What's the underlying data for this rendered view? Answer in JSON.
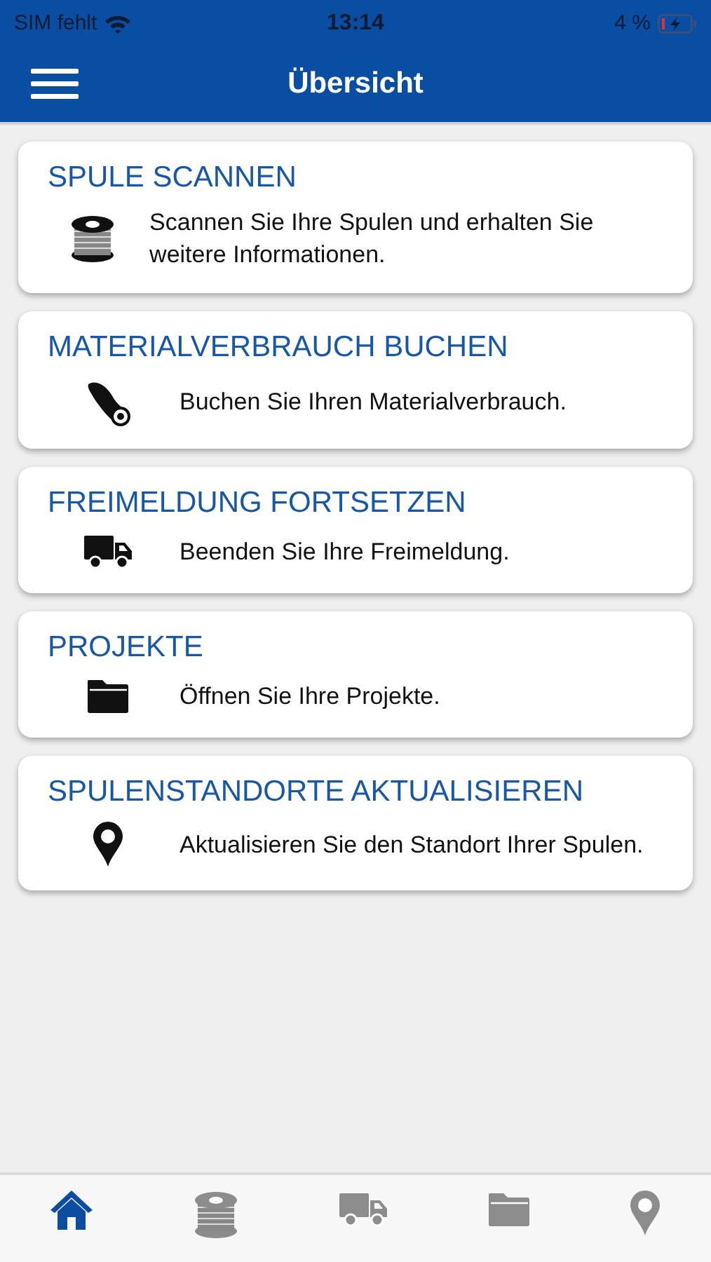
{
  "status_bar": {
    "carrier": "SIM fehlt",
    "time": "13:14",
    "battery": "4 %"
  },
  "nav_bar": {
    "title": "Übersicht"
  },
  "cards": [
    {
      "kind": "spool",
      "title": "SPULE SCANNEN",
      "description": "Scannen Sie Ihre Spulen und erhalten Sie weitere Informationen."
    },
    {
      "kind": "cable",
      "title": "MATERIALVERBRAUCH BUCHEN",
      "description": "Buchen Sie Ihren Materialverbrauch."
    },
    {
      "kind": "truck",
      "title": "FREIMELDUNG FORTSETZEN",
      "description": "Beenden Sie Ihre Freimeldung."
    },
    {
      "kind": "folder",
      "title": "PROJEKTE",
      "description": "Öffnen Sie Ihre Projekte."
    },
    {
      "kind": "pin",
      "title": "SPULENSTANDORTE AKTUALISIEREN",
      "description": "Aktualisieren Sie den Standort Ihrer Spulen."
    }
  ],
  "tab_bar": [
    {
      "kind": "home",
      "selected": true
    },
    {
      "kind": "spool",
      "selected": false
    },
    {
      "kind": "truck",
      "selected": false
    },
    {
      "kind": "folder",
      "selected": false
    },
    {
      "kind": "pin",
      "selected": false
    }
  ]
}
